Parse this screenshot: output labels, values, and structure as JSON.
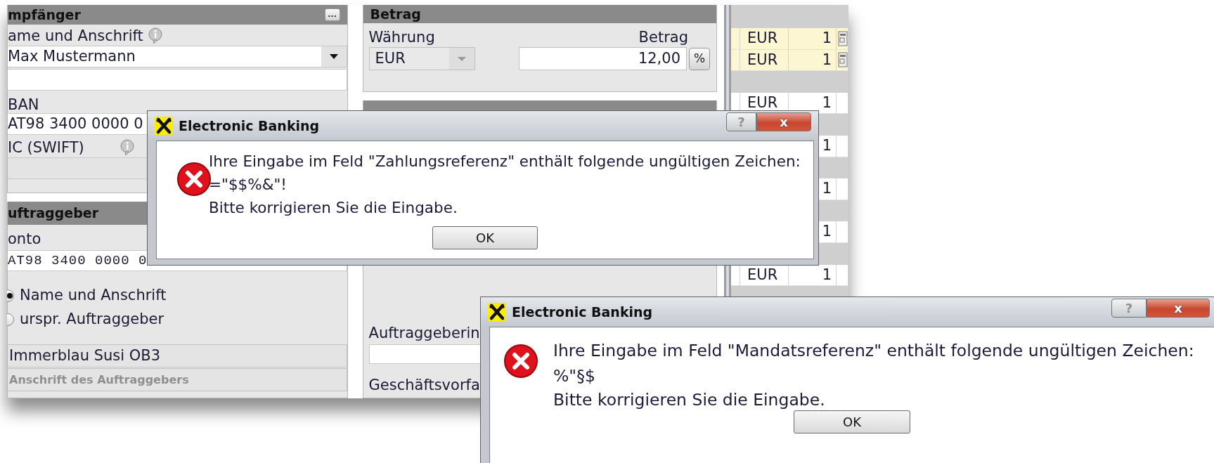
{
  "app": {
    "recipient_panel": {
      "title": "mpfänger",
      "more_button": "...",
      "name_label": "ame und Anschrift",
      "name_value": "Max Mustermann",
      "iban_label": "BAN",
      "iban_value": "AT98 3400 0000 0",
      "bic_label": "IC (SWIFT)"
    },
    "originator_panel": {
      "title": "uftraggeber",
      "account_label": "onto",
      "account_value": "AT98 3400 0000 0",
      "options": [
        {
          "label": "Name und Anschrift",
          "selected": true
        },
        {
          "label": "urspr. Auftraggeber",
          "selected": false
        }
      ],
      "name_value": "Immerblau Susi OB3",
      "address_placeholder": "Anschrift des Auftraggebers"
    },
    "amount_panel": {
      "title": "Betrag",
      "currency_label": "Währung",
      "currency_value": "EUR",
      "amount_label": "Betrag",
      "amount_value": "12,00",
      "percent_button": "%"
    },
    "info_panel": {
      "originator_info_label": "Auftraggeberin",
      "business_case_label": "Geschäftsvorfa"
    },
    "table": {
      "rows": [
        {
          "kind": "group"
        },
        {
          "kind": "item",
          "currency": "EUR",
          "count": "1",
          "highlighted": true
        },
        {
          "kind": "item",
          "currency": "EUR",
          "count": "1",
          "highlighted": true
        },
        {
          "kind": "group"
        },
        {
          "kind": "item",
          "currency": "EUR",
          "count": "1",
          "highlighted": false
        },
        {
          "kind": "group"
        },
        {
          "kind": "item",
          "count": "1",
          "highlighted": false
        },
        {
          "kind": "group"
        },
        {
          "kind": "item",
          "count": "1",
          "highlighted": false
        },
        {
          "kind": "group"
        },
        {
          "kind": "item",
          "count": "1",
          "highlighted": false
        },
        {
          "kind": "group"
        },
        {
          "kind": "item",
          "currency": "EUR",
          "count": "1",
          "highlighted": false
        },
        {
          "kind": "group"
        }
      ]
    }
  },
  "dialogs": [
    {
      "title": "Electronic Banking",
      "help_button": "?",
      "close_button": "x",
      "message": [
        "Ihre Eingabe im Feld \"Zahlungsreferenz\" enthält folgende ungültigen Zeichen:",
        "=\"$$%&\"!",
        "Bitte korrigieren Sie die Eingabe."
      ],
      "button": "OK"
    },
    {
      "title": "Electronic Banking",
      "help_button": "?",
      "close_button": "x",
      "message": [
        "Ihre Eingabe im Feld \"Mandatsreferenz\" enthält folgende ungültigen Zeichen:",
        "%\"§$",
        "Bitte korrigieren Sie die Eingabe."
      ],
      "button": "OK"
    }
  ]
}
